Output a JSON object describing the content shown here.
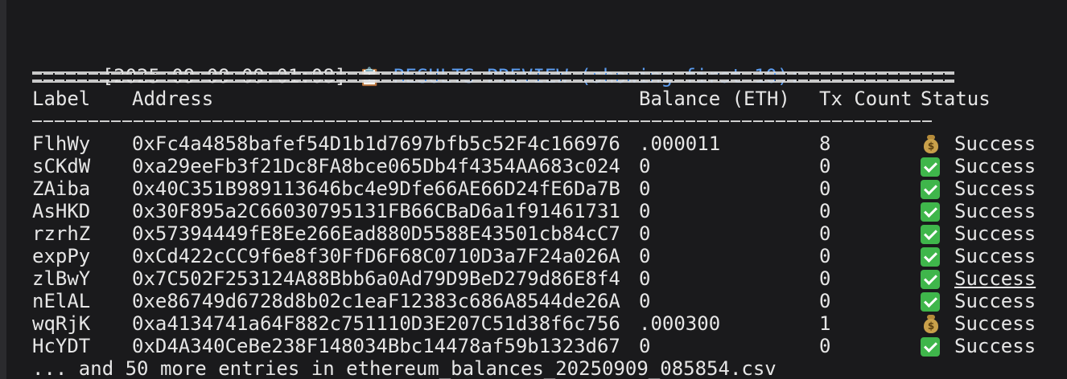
{
  "header": {
    "timestamp": "[2025-09-09 09:01:08]",
    "clipboard_icon": "clipboard-icon",
    "title": "RESULTS PREVIEW (showing first 10):",
    "title_color": "#5b9cf0"
  },
  "table": {
    "columns": [
      "Label",
      "Address",
      "Balance (ETH)",
      "Tx Count",
      "Status"
    ],
    "rows": [
      {
        "label": "FlhWy",
        "address": "0xFc4a4858bafef54D1b1d7697bfb5c52F4c166976",
        "balance": ".000011",
        "tx": "8",
        "icon": "money-bag-icon",
        "status": "Success"
      },
      {
        "label": "sCKdW",
        "address": "0xa29eeFb3f21Dc8FA8bce065Db4f4354AA683c024",
        "balance": "0",
        "tx": "0",
        "icon": "check-mark-icon",
        "status": "Success"
      },
      {
        "label": "ZAiba",
        "address": "0x40C351B989113646bc4e9Dfe66AE66D24fE6Da7B",
        "balance": "0",
        "tx": "0",
        "icon": "check-mark-icon",
        "status": "Success"
      },
      {
        "label": "AsHKD",
        "address": "0x30F895a2C66030795131FB66CBaD6a1f91461731",
        "balance": "0",
        "tx": "0",
        "icon": "check-mark-icon",
        "status": "Success"
      },
      {
        "label": "rzrhZ",
        "address": "0x57394449fE8Ee266Ead880D5588E43501cb84cC7",
        "balance": "0",
        "tx": "0",
        "icon": "check-mark-icon",
        "status": "Success"
      },
      {
        "label": "expPy",
        "address": "0xCd422cCC9f6e8f30FfD6F68C0710D3a7F24a026A",
        "balance": "0",
        "tx": "0",
        "icon": "check-mark-icon",
        "status": "Success"
      },
      {
        "label": "zlBwY",
        "address": "0x7C502F253124A88Bbb6a0Ad79D9BeD279d86E8f4",
        "balance": "0",
        "tx": "0",
        "icon": "check-mark-icon",
        "status": "Success"
      },
      {
        "label": "nElAL",
        "address": "0xe86749d6728d8b02c1eaF12383c686A8544de26A",
        "balance": "0",
        "tx": "0",
        "icon": "check-mark-icon",
        "status": "Success"
      },
      {
        "label": "wqRjK",
        "address": "0xa4134741a64F882c751110D3E207C51d38f6c756",
        "balance": ".000300",
        "tx": "1",
        "icon": "money-bag-icon",
        "status": "Success"
      },
      {
        "label": "HcYDT",
        "address": "0xD4A340CeBe238F148034Bbc14478af59b1323d67",
        "balance": "0",
        "tx": "0",
        "icon": "check-mark-icon",
        "status": "Success"
      }
    ]
  },
  "footer": {
    "text": "... and 50 more entries in ethereum_balances_20250909_085854.csv"
  },
  "colors": {
    "background": "#1a1a1c",
    "text": "#e6e6e6",
    "check_green": "#3fb64b"
  }
}
